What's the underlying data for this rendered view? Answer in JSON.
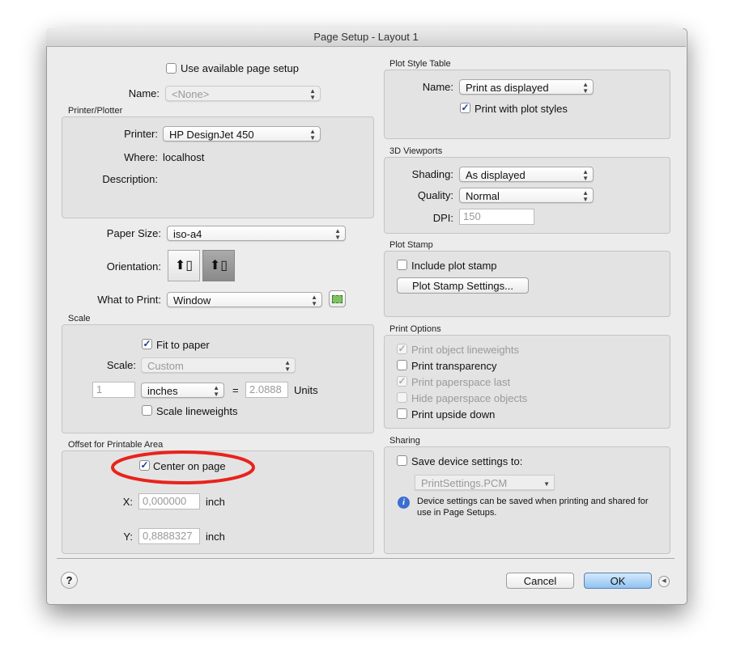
{
  "window": {
    "title": "Page Setup - Layout 1"
  },
  "page_setup": {
    "use_available_label": "Use available page setup",
    "use_available_checked": false,
    "name_label": "Name:",
    "name_value": "<None>"
  },
  "printer": {
    "group_label": "Printer/Plotter",
    "printer_label": "Printer:",
    "printer_value": "HP DesignJet 450",
    "where_label": "Where:",
    "where_value": "localhost",
    "description_label": "Description:"
  },
  "paper": {
    "size_label": "Paper Size:",
    "size_value": "iso-a4",
    "orientation_label": "Orientation:",
    "orientation_selected": "landscape",
    "what_label": "What to Print:",
    "what_value": "Window"
  },
  "scale": {
    "group_label": "Scale",
    "fit_label": "Fit to paper",
    "fit_checked": true,
    "scale_label": "Scale:",
    "scale_value": "Custom",
    "amount": "1",
    "unit": "inches",
    "equals": "=",
    "units_value": "2.0888",
    "units_label": "Units",
    "lineweights_label": "Scale lineweights",
    "lineweights_checked": false
  },
  "offset": {
    "group_label": "Offset for Printable Area",
    "center_label": "Center on page",
    "center_checked": true,
    "x_label": "X:",
    "x_value": "0,000000",
    "x_unit": "inch",
    "y_label": "Y:",
    "y_value": "0,8888327",
    "y_unit": "inch",
    "highlight_color": "#e8231c"
  },
  "plot_style": {
    "group_label": "Plot Style Table",
    "name_label": "Name:",
    "name_value": "Print as displayed",
    "with_styles_label": "Print with plot styles",
    "with_styles_checked": true
  },
  "viewports": {
    "group_label": "3D Viewports",
    "shading_label": "Shading:",
    "shading_value": "As displayed",
    "quality_label": "Quality:",
    "quality_value": "Normal",
    "dpi_label": "DPI:",
    "dpi_value": "150"
  },
  "plot_stamp": {
    "group_label": "Plot Stamp",
    "include_label": "Include plot stamp",
    "include_checked": false,
    "settings_button": "Plot Stamp Settings..."
  },
  "print_options": {
    "group_label": "Print Options",
    "items": [
      {
        "label": "Print object lineweights",
        "checked": true,
        "enabled": false
      },
      {
        "label": "Print transparency",
        "checked": false,
        "enabled": true
      },
      {
        "label": "Print paperspace last",
        "checked": true,
        "enabled": false
      },
      {
        "label": "Hide paperspace objects",
        "checked": false,
        "enabled": false
      },
      {
        "label": "Print upside down",
        "checked": false,
        "enabled": true
      }
    ]
  },
  "sharing": {
    "group_label": "Sharing",
    "save_label": "Save device settings to:",
    "save_checked": false,
    "file_value": "PrintSettings.PCM",
    "info_text": "Device settings can be saved when printing and shared for use in Page Setups."
  },
  "footer": {
    "help": "?",
    "cancel": "Cancel",
    "ok": "OK"
  }
}
